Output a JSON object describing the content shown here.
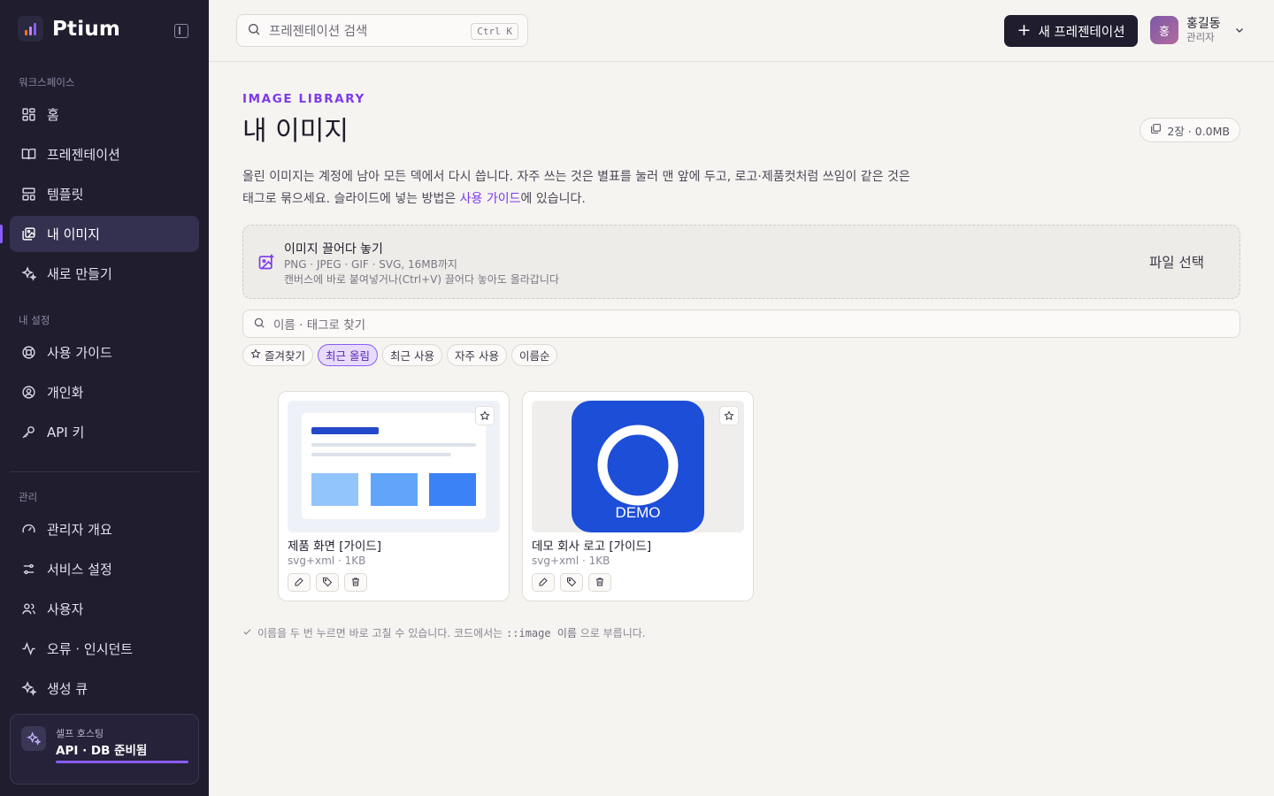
{
  "brand": {
    "name": "Ptium",
    "logo_colors": [
      "#f97316",
      "#a855f7",
      "#8b5cf6"
    ]
  },
  "sidebar": {
    "workspace_label": "워크스페이스",
    "workspace_items": [
      {
        "label": "홈",
        "icon": "grid-icon"
      },
      {
        "label": "프레젠테이션",
        "icon": "book-icon"
      },
      {
        "label": "템플릿",
        "icon": "layout-icon"
      },
      {
        "label": "내 이미지",
        "icon": "images-icon",
        "active": true
      },
      {
        "label": "새로 만들기",
        "icon": "sparkles-icon"
      }
    ],
    "settings_label": "내 설정",
    "settings_items": [
      {
        "label": "사용 가이드",
        "icon": "lifebuoy-icon"
      },
      {
        "label": "개인화",
        "icon": "user-circle-icon"
      },
      {
        "label": "API 키",
        "icon": "key-icon"
      }
    ],
    "admin_label": "관리",
    "admin_items": [
      {
        "label": "관리자 개요",
        "icon": "gauge-icon"
      },
      {
        "label": "서비스 설정",
        "icon": "sliders-icon"
      },
      {
        "label": "사용자",
        "icon": "users-icon"
      },
      {
        "label": "오류 · 인시던트",
        "icon": "activity-icon"
      },
      {
        "label": "생성 큐",
        "icon": "sparkles-icon"
      }
    ],
    "status": {
      "small": "셀프 호스팅",
      "main": "API · DB 준비됨"
    }
  },
  "topbar": {
    "search_placeholder": "프레젠테이션 검색",
    "search_shortcut": "Ctrl K",
    "new_button": "새 프레젠테이션",
    "user": {
      "initial": "홍",
      "name": "홍길동",
      "role": "관리자"
    }
  },
  "main": {
    "eyebrow": "IMAGE LIBRARY",
    "title": "내 이미지",
    "count_badge": "2장 · 0.0MB",
    "desc_line1": "올린 이미지는 계정에 남아 모든 덱에서 다시 씁니다. 자주 쓰는 것은 별표를 눌러 맨 앞에 두고, 로고·제품컷처럼 쓰임이 같은 것은",
    "desc_line2_pre": "태그로 묶으세요. 슬라이드에 넣는 방법은 ",
    "desc_link": "사용 가이드",
    "desc_line2_post": "에 있습니다.",
    "dropzone": {
      "title": "이미지 끌어다 놓기",
      "formats": "PNG · JPEG · GIF · SVG, 16MB까지",
      "paste_hint": "캔버스에 바로 붙여넣거나(Ctrl+V) 끌어다 놓아도 올라갑니다",
      "button": "파일 선택"
    },
    "filter_placeholder": "이름 · 태그로 찾기",
    "chips": [
      {
        "label": "즐겨찾기",
        "icon": "star-icon",
        "active": false
      },
      {
        "label": "최근 올림",
        "active": true
      },
      {
        "label": "최근 사용",
        "active": false
      },
      {
        "label": "자주 사용",
        "active": false
      },
      {
        "label": "이름순",
        "active": false
      }
    ],
    "images": [
      {
        "title": "제품 화면 [가이드]",
        "meta": "svg+xml · 1KB"
      },
      {
        "title": "데모 회사 로고 [가이드]",
        "meta": "svg+xml · 1KB",
        "logo_text": "DEMO"
      }
    ],
    "hint_pre": "이름을 두 번 누르면 바로 고칠 수 있습니다. 코드에서는 ",
    "hint_code": "::image 이름",
    "hint_post": " 으로 부릅니다."
  }
}
